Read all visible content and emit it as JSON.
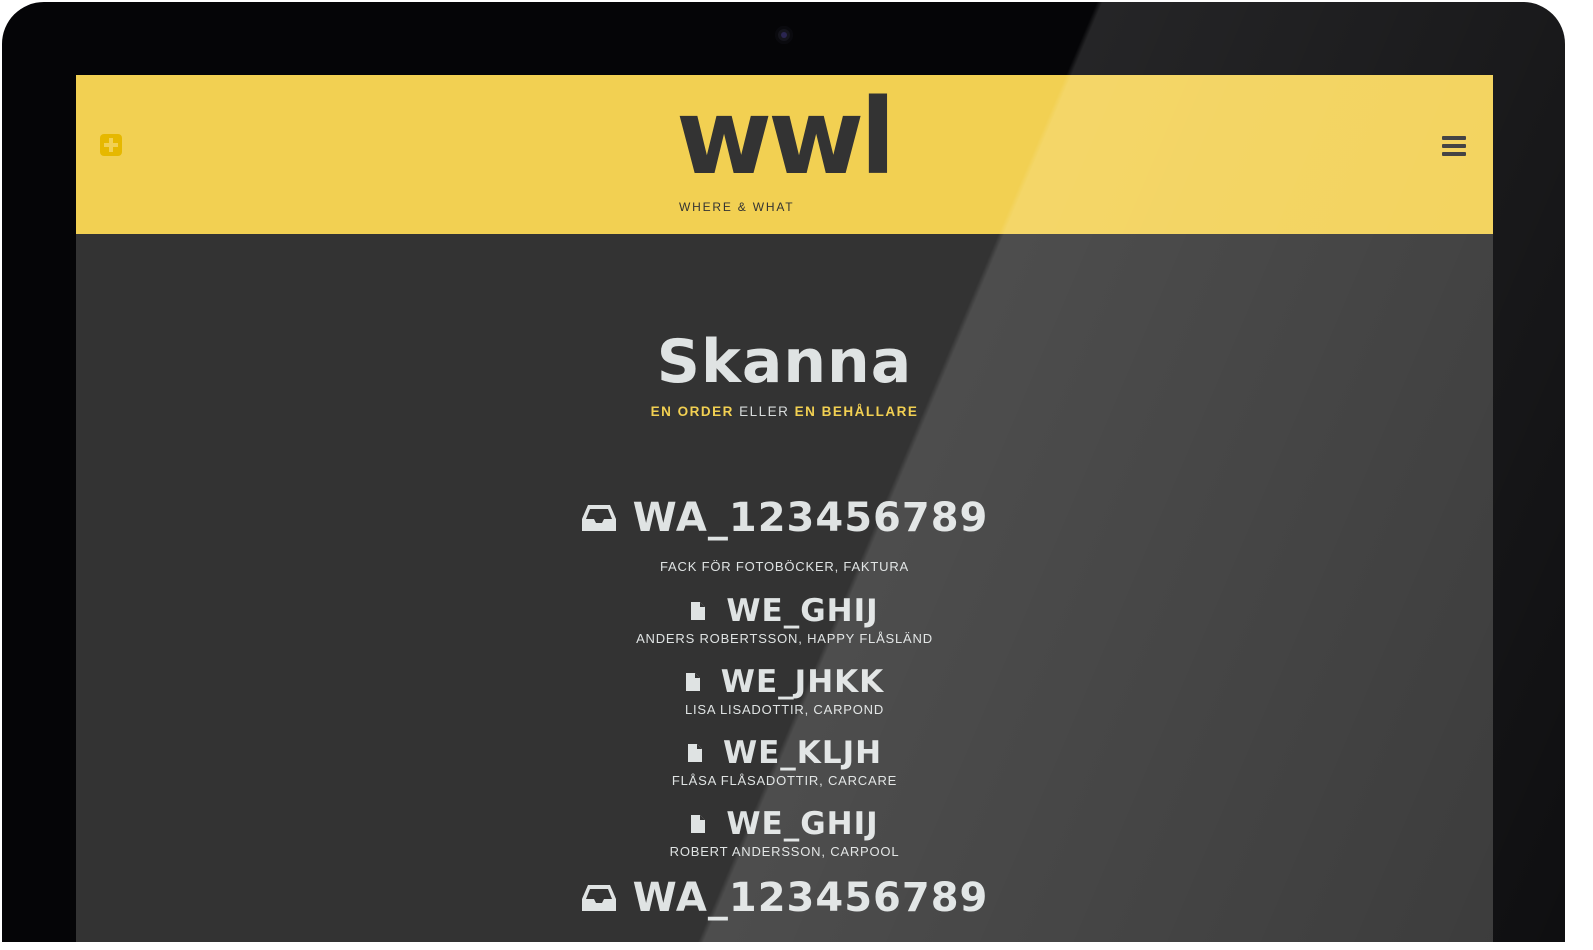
{
  "header": {
    "logo": "wwl",
    "tagline": "WHERE & WHAT"
  },
  "main": {
    "title": "Skanna",
    "subtitle": {
      "part1": "EN ORDER",
      "part2": " ELLER ",
      "part3": "EN BEHÅLLARE"
    },
    "items": [
      {
        "type": "container",
        "icon": "inbox-icon",
        "code": "WA_123456789",
        "desc": "FACK FÖR FOTOBÖCKER, FAKTURA"
      },
      {
        "type": "order",
        "icon": "document-icon",
        "code": "WE_GHIJ",
        "desc": "ANDERS ROBERTSSON, HAPPY FLÅSLÄND"
      },
      {
        "type": "order",
        "icon": "document-icon",
        "code": "WE_JHKK",
        "desc": "LISA LISADOTTIR, CARPOND"
      },
      {
        "type": "order",
        "icon": "document-icon",
        "code": "WE_KLJH",
        "desc": "FLÅSA FLÅSADOTTIR, CARCARE"
      },
      {
        "type": "order",
        "icon": "document-icon",
        "code": "WE_GHIJ",
        "desc": "ROBERT ANDERSSON, CARPOOL"
      },
      {
        "type": "container",
        "icon": "inbox-icon",
        "code": "WA_123456789",
        "desc": ""
      }
    ]
  },
  "colors": {
    "header_bg": "#f2d052",
    "body_bg": "#333333",
    "accent": "#f2d052",
    "text": "#dfe3e3"
  }
}
